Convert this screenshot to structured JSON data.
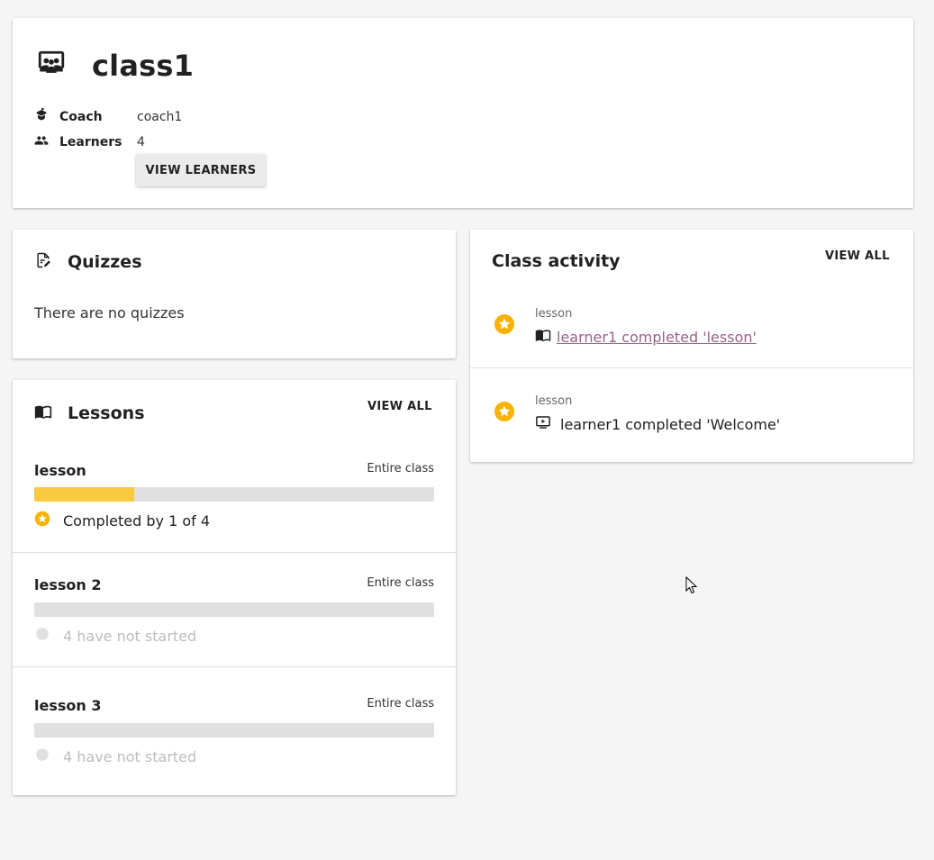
{
  "class_info": {
    "name": "class1",
    "coach_label": "Coach",
    "coach_value": "coach1",
    "learners_label": "Learners",
    "learners_value": "4",
    "view_learners_label": "VIEW LEARNERS"
  },
  "quizzes": {
    "title": "Quizzes",
    "empty_text": "There are no quizzes"
  },
  "lessons": {
    "title": "Lessons",
    "view_all_label": "VIEW ALL",
    "items": [
      {
        "name": "lesson",
        "assignment": "Entire class",
        "progress": 0.25,
        "status": "Completed by 1 of 4"
      },
      {
        "name": "lesson 2",
        "assignment": "Entire class",
        "progress": 0,
        "status": "4 have not started"
      },
      {
        "name": "lesson 3",
        "assignment": "Entire class",
        "progress": 0,
        "status": "4 have not started"
      }
    ]
  },
  "activity": {
    "title": "Class activity",
    "view_all_label": "VIEW ALL",
    "items": [
      {
        "kind": "lesson",
        "text": "learner1 completed 'lesson'",
        "icon": "lesson-book-icon"
      },
      {
        "kind": "lesson",
        "text": "learner1 completed 'Welcome'",
        "icon": "video-resource-icon"
      }
    ]
  },
  "colors": {
    "accent_star": "#f8b200",
    "progress_fill": "#f8ca40",
    "link": "#996189",
    "muted": "#bdbdbd"
  }
}
